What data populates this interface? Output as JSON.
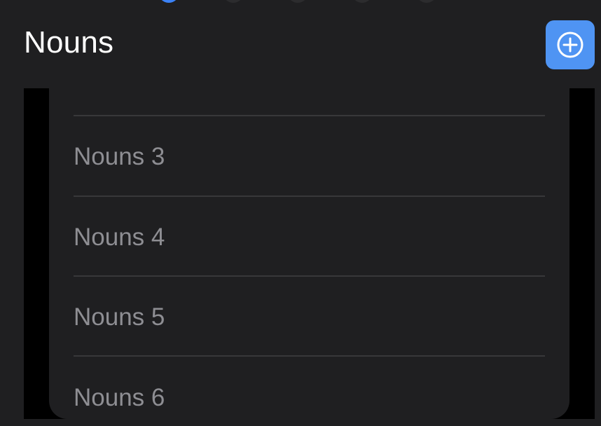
{
  "header": {
    "title": "Nouns",
    "add_icon": "plus-circle-icon"
  },
  "page_indicator": {
    "count": 5,
    "active_index": 0
  },
  "list": {
    "items": [
      {
        "label": "Nouns 3"
      },
      {
        "label": "Nouns 4"
      },
      {
        "label": "Nouns 5"
      },
      {
        "label": "Nouns 6"
      }
    ]
  },
  "colors": {
    "background": "#1f1f21",
    "accent": "#4f94f3",
    "item_text": "#8e8e93",
    "divider": "#38383a"
  }
}
